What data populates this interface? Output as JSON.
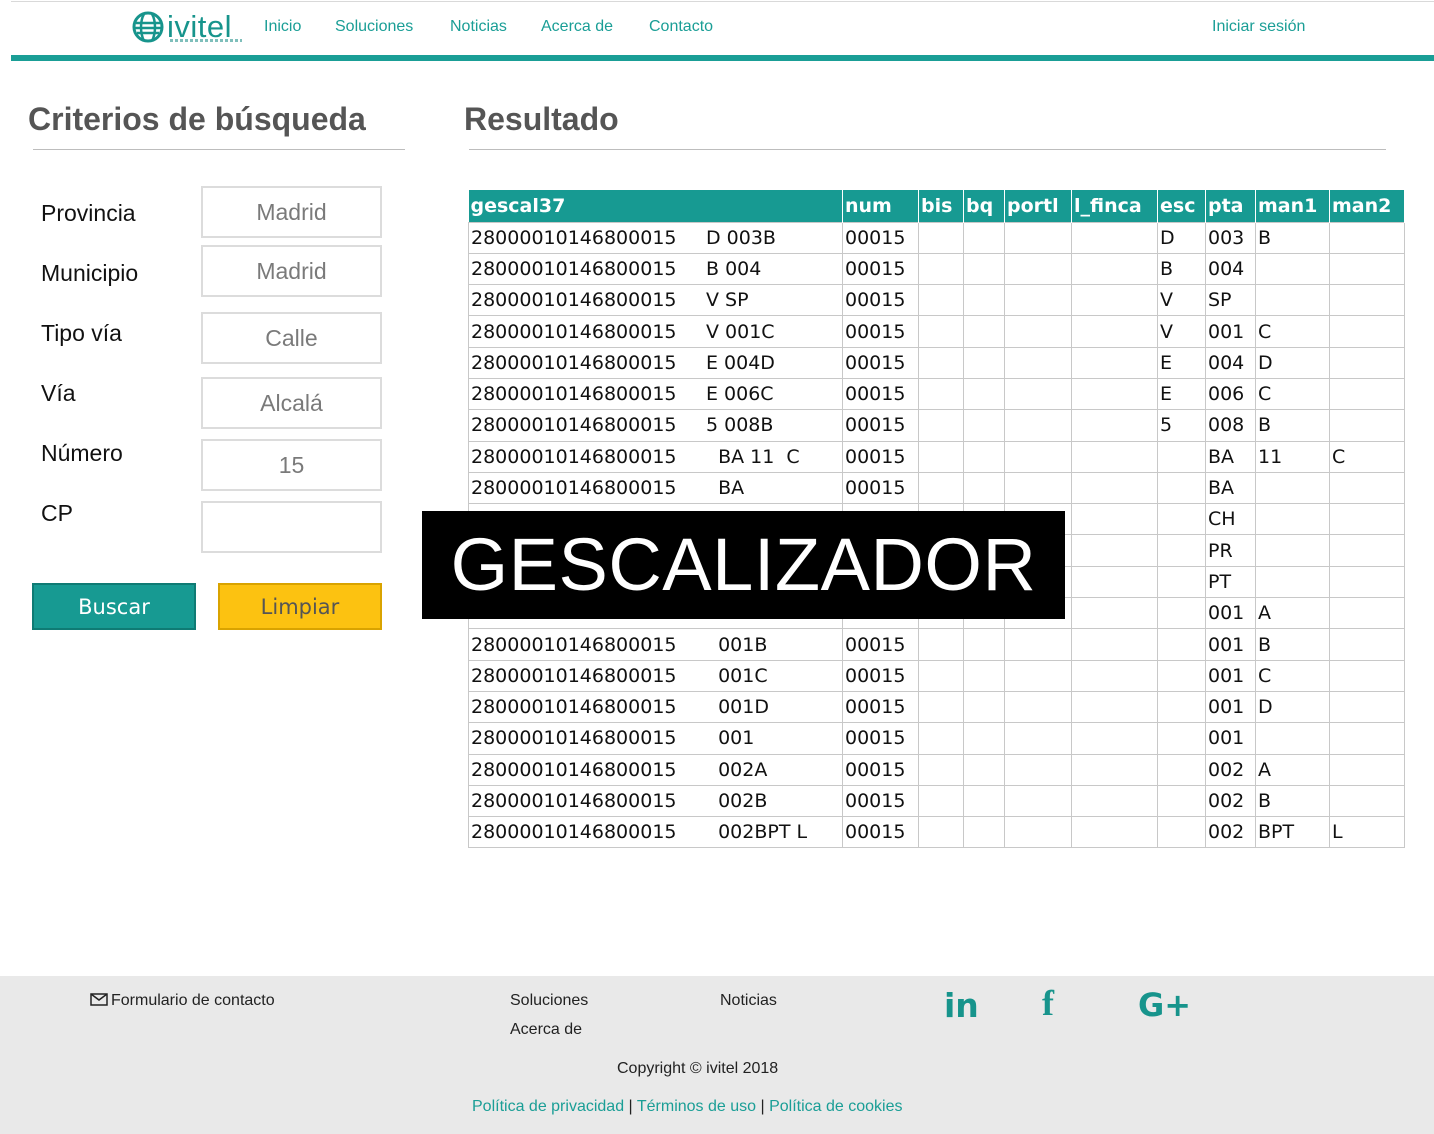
{
  "brand": {
    "name": "ivitel",
    "color": "#1a9e96"
  },
  "nav": {
    "items": [
      "Inicio",
      "Soluciones",
      "Noticias",
      "Acerca de",
      "Contacto"
    ],
    "login": "Iniciar sesión"
  },
  "search": {
    "title": "Criterios de búsqueda",
    "fields": [
      {
        "label": "Provincia",
        "value": "Madrid"
      },
      {
        "label": "Municipio",
        "value": "Madrid"
      },
      {
        "label": "Tipo vía",
        "value": "Calle"
      },
      {
        "label": "Vía",
        "value": "Alcalá"
      },
      {
        "label": "Número",
        "value": "15"
      },
      {
        "label": "CP",
        "value": ""
      }
    ],
    "search_button": "Buscar",
    "clear_button": "Limpiar"
  },
  "results": {
    "title": "Resultado",
    "columns": [
      "gescal37",
      "num",
      "bis",
      "bq",
      "portl",
      "l_finca",
      "esc",
      "pta",
      "man1",
      "man2"
    ],
    "rows": [
      [
        "28000010146800015",
        "D 003B",
        "00015",
        "",
        "",
        "",
        "",
        "D",
        "003",
        "B",
        ""
      ],
      [
        "28000010146800015",
        "B 004",
        "00015",
        "",
        "",
        "",
        "",
        "B",
        "004",
        "",
        ""
      ],
      [
        "28000010146800015",
        "V SP",
        "00015",
        "",
        "",
        "",
        "",
        "V",
        "SP",
        "",
        ""
      ],
      [
        "28000010146800015",
        "V 001C",
        "00015",
        "",
        "",
        "",
        "",
        "V",
        "001",
        "C",
        ""
      ],
      [
        "28000010146800015",
        "E 004D",
        "00015",
        "",
        "",
        "",
        "",
        "E",
        "004",
        "D",
        ""
      ],
      [
        "28000010146800015",
        "E 006C",
        "00015",
        "",
        "",
        "",
        "",
        "E",
        "006",
        "C",
        ""
      ],
      [
        "28000010146800015",
        "5 008B",
        "00015",
        "",
        "",
        "",
        "",
        "5",
        "008",
        "B",
        ""
      ],
      [
        "28000010146800015",
        "  BA 11  C",
        "00015",
        "",
        "",
        "",
        "",
        "",
        "BA",
        "11",
        "C"
      ],
      [
        "28000010146800015",
        "  BA",
        "00015",
        "",
        "",
        "",
        "",
        "",
        "BA",
        "",
        ""
      ],
      [
        "",
        "",
        "",
        "",
        "",
        "",
        "",
        "",
        "CH",
        "",
        ""
      ],
      [
        "",
        "",
        "",
        "",
        "",
        "",
        "",
        "",
        "PR",
        "",
        ""
      ],
      [
        "",
        "",
        "",
        "",
        "",
        "",
        "",
        "",
        "PT",
        "",
        ""
      ],
      [
        "",
        "",
        "",
        "",
        "",
        "",
        "",
        "",
        "001",
        "A",
        ""
      ],
      [
        "28000010146800015",
        "  001B",
        "00015",
        "",
        "",
        "",
        "",
        "",
        "001",
        "B",
        ""
      ],
      [
        "28000010146800015",
        "  001C",
        "00015",
        "",
        "",
        "",
        "",
        "",
        "001",
        "C",
        ""
      ],
      [
        "28000010146800015",
        "  001D",
        "00015",
        "",
        "",
        "",
        "",
        "",
        "001",
        "D",
        ""
      ],
      [
        "28000010146800015",
        "  001",
        "00015",
        "",
        "",
        "",
        "",
        "",
        "001",
        "",
        ""
      ],
      [
        "28000010146800015",
        "  002A",
        "00015",
        "",
        "",
        "",
        "",
        "",
        "002",
        "A",
        ""
      ],
      [
        "28000010146800015",
        "  002B",
        "00015",
        "",
        "",
        "",
        "",
        "",
        "002",
        "B",
        ""
      ],
      [
        "28000010146800015",
        "  002BPT L",
        "00015",
        "",
        "",
        "",
        "",
        "",
        "002",
        "BPT",
        "L"
      ]
    ]
  },
  "overlay": {
    "text": "GESCALIZADOR"
  },
  "footer": {
    "contact": "Formulario de contacto",
    "links_col1": [
      "Soluciones",
      "Acerca de"
    ],
    "links_col2": [
      "Noticias"
    ],
    "social": [
      "linkedin-icon",
      "facebook-icon",
      "google-plus-icon"
    ],
    "copyright": "Copyright © ivitel 2018",
    "legal": [
      "Política de privacidad",
      "Términos de uso",
      "Política de cookies"
    ],
    "legal_separator": "|"
  }
}
